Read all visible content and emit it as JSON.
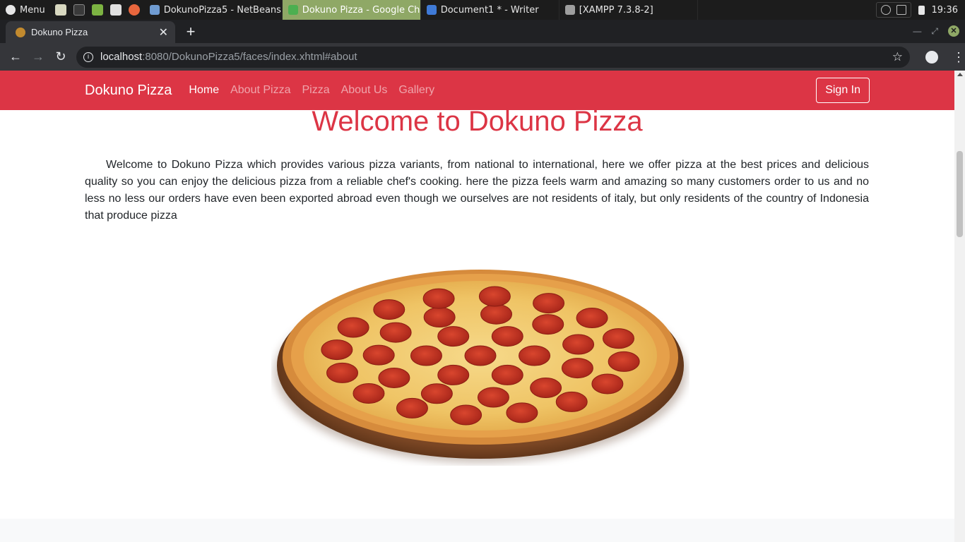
{
  "taskbar": {
    "menu_label": "Menu",
    "windows": [
      {
        "title": "DokunoPizza5 - NetBeans ...",
        "active": false,
        "icon": "netbeans-icon"
      },
      {
        "title": "Dokuno Pizza - Google Ch...",
        "active": true,
        "icon": "chrome-icon"
      },
      {
        "title": "Document1 * - Writer",
        "active": false,
        "icon": "writer-icon"
      },
      {
        "title": "[XAMPP 7.3.8-2]",
        "active": false,
        "icon": "xampp-icon"
      }
    ],
    "clock": "19:36"
  },
  "browser": {
    "tab_title": "Dokuno Pizza",
    "url_host": "localhost",
    "url_path": ":8080/DokunoPizza5/faces/index.xhtml#about"
  },
  "site": {
    "brand": "Dokuno Pizza",
    "nav": [
      "Home",
      "About Pizza",
      "Pizza",
      "About Us",
      "Gallery"
    ],
    "active_nav": "Home",
    "signin_label": "Sign In",
    "title": "Welcome to Dokuno Pizza",
    "intro": "Welcome to Dokuno Pizza which provides various pizza variants, from national to international, here we offer pizza at the best prices and delicious quality so you can enjoy the delicious pizza from a reliable chef's cooking. here the pizza feels warm and amazing so many customers order to us and no less no less our orders have even been exported abroad even though we ourselves are not residents of italy, but only residents of the country of Indonesia that produce pizza",
    "image_subject": "pepperoni-pizza"
  },
  "colors": {
    "brand_red": "#dc3545",
    "taskbar_active": "#8fa866"
  }
}
